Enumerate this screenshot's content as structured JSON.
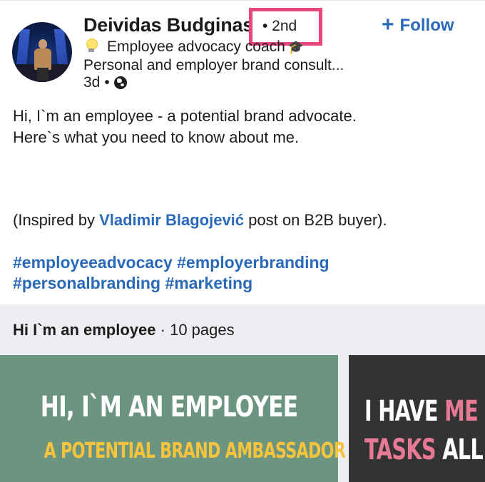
{
  "post": {
    "author": {
      "name": "Deividas Budginas",
      "connection_degree": "• 2nd",
      "headline_text": "Employee advocacy coach",
      "headline_icon": "lightbulb-icon",
      "headline_trailing_icon": "graduation-cap-icon",
      "subheadline": "Personal and employer brand consult...",
      "time": "3d",
      "separator": "•",
      "visibility_icon": "globe-icon"
    },
    "follow_label": "Follow",
    "follow_icon": "plus-icon",
    "body_line1": "Hi, I`m an employee - a potential brand advocate.",
    "body_line2": "Here`s what you need to know about me.",
    "inspired_prefix": "(Inspired by ",
    "inspired_link": "Vladimir Blagojević",
    "inspired_suffix": " post on B2B buyer).",
    "hashtags": [
      "#employeeadvocacy",
      "#employerbranding",
      "#personalbranding",
      "#marketing"
    ],
    "highlight_color": "#e9477a",
    "link_color": "#2a6ab8"
  },
  "document": {
    "title": "Hi I`m an employee",
    "pages_label": "· 10 pages",
    "slide1_line1": "HI, I`M AN EMPLOYEE",
    "slide1_line2": "A POTENTIAL BRAND AMBASSADOR",
    "slide2_line1_white": "I HAVE ",
    "slide2_line1_pink": "ME",
    "slide2_line2_pink": "TASKS ",
    "slide2_line2_white": "ALL",
    "slide1_bg": "#6b9481",
    "slide1_accent": "#f6c43c",
    "slide2_bg": "#333333",
    "slide2_accent": "#e67a95"
  }
}
